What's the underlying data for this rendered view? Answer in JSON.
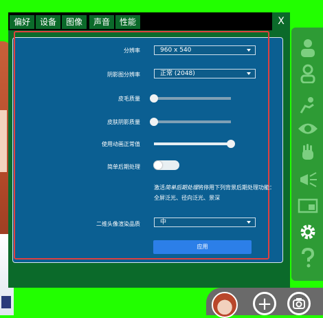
{
  "tabs": [
    {
      "label": "偏好"
    },
    {
      "label": "设备"
    },
    {
      "label": "图像"
    },
    {
      "label": "声音"
    },
    {
      "label": "性能"
    }
  ],
  "active_tab": "图像",
  "close_label": "X",
  "settings": {
    "resolution": {
      "label": "分辨率",
      "value": "960 x 540"
    },
    "shadow_resolution": {
      "label": "阴影图分辨率",
      "value": "正常 (2048)"
    },
    "fur_quality": {
      "label": "皮毛质量",
      "value_fraction": 0.0
    },
    "skin_shadow_quality": {
      "label": "皮肤阴影质量",
      "value_fraction": 0.0
    },
    "normal_animation": {
      "label": "使用动画正常值",
      "value_fraction": 1.0
    },
    "simple_postprocess": {
      "label": "简单后期处理",
      "enabled": false
    },
    "note_prefix": "激活",
    "note_em": "简单后期处理",
    "note_suffix": "将停用下列背景后期处理功能：全屏泛光、径向泛光、景深",
    "quality_2d": {
      "label": "二维头像渲染品质",
      "value": "中"
    },
    "apply_label": "应用"
  },
  "toolbar_icons": [
    "person-icon",
    "person-outline-icon",
    "gesture-icon",
    "eye-icon",
    "hand-icon",
    "megaphone-icon",
    "display-icon",
    "settings-icon",
    "help-icon"
  ],
  "bottom": {
    "add_label": "+",
    "camera_icon": "camera-icon"
  },
  "colors": {
    "background": "#22ff00",
    "panel": "#0b5f92",
    "apply": "#2c7fe8",
    "highlight": "#e0403f"
  }
}
